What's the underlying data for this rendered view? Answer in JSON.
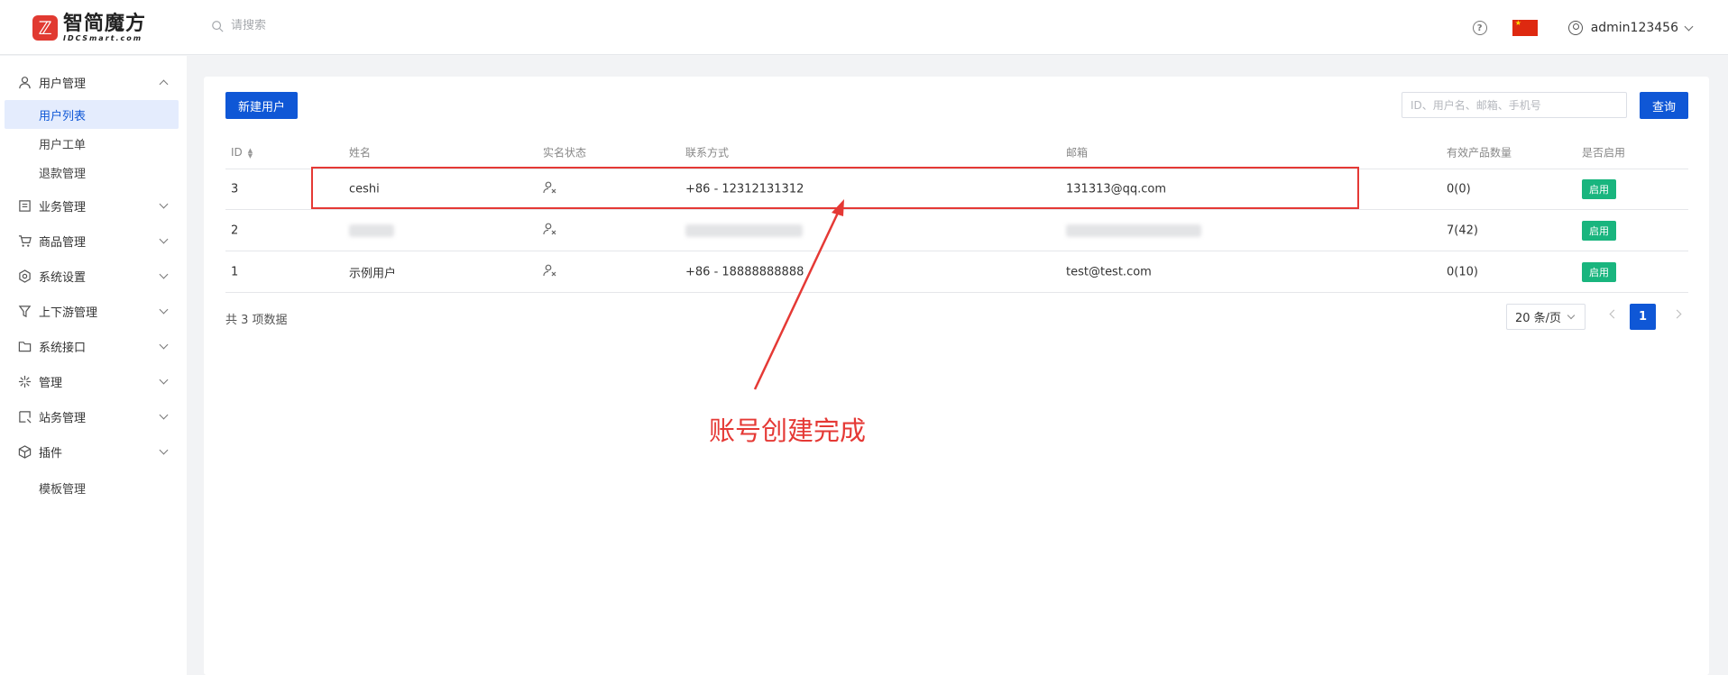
{
  "header": {
    "logo_cn": "智简魔方",
    "logo_en": "IDCSmart.com",
    "search_placeholder": "请搜索",
    "username": "admin123456"
  },
  "sidebar": {
    "groups": [
      {
        "label": "用户管理",
        "icon": "user-icon",
        "expanded": true
      },
      {
        "label": "业务管理",
        "icon": "document-icon"
      },
      {
        "label": "商品管理",
        "icon": "cart-icon"
      },
      {
        "label": "系统设置",
        "icon": "gear-icon"
      },
      {
        "label": "上下游管理",
        "icon": "filter-icon"
      },
      {
        "label": "系统接口",
        "icon": "folder-icon"
      },
      {
        "label": "管理",
        "icon": "sparkle-icon"
      },
      {
        "label": "站务管理",
        "icon": "site-icon"
      },
      {
        "label": "插件",
        "icon": "cube-icon"
      }
    ],
    "sub_items": [
      "用户列表",
      "用户工单",
      "退款管理"
    ],
    "template_item": "模板管理"
  },
  "toolbar": {
    "new_user_label": "新建用户",
    "filter_placeholder": "ID、用户名、邮箱、手机号",
    "query_label": "查询"
  },
  "table": {
    "headers": [
      "ID",
      "姓名",
      "实名状态",
      "联系方式",
      "邮箱",
      "有效产品数量",
      "是否启用"
    ],
    "rows": [
      {
        "id": "3",
        "name": "ceshi",
        "phone": "+86 - 12312131312",
        "email": "131313@qq.com",
        "count": "0(0)",
        "enabled": "启用"
      },
      {
        "id": "2",
        "name": "",
        "phone": "",
        "email": "",
        "count": "7(42)",
        "enabled": "启用"
      },
      {
        "id": "1",
        "name": "示例用户",
        "phone": "+86 - 18888888888",
        "email": "test@test.com",
        "count": "0(10)",
        "enabled": "启用"
      }
    ]
  },
  "footer": {
    "total_text": "共 3 项数据",
    "page_size": "20 条/页",
    "current_page": "1"
  },
  "annotation": {
    "text": "账号创建完成",
    "color": "#e53935"
  },
  "colors": {
    "primary": "#0f57d6",
    "enabled_badge": "#19b57e"
  }
}
